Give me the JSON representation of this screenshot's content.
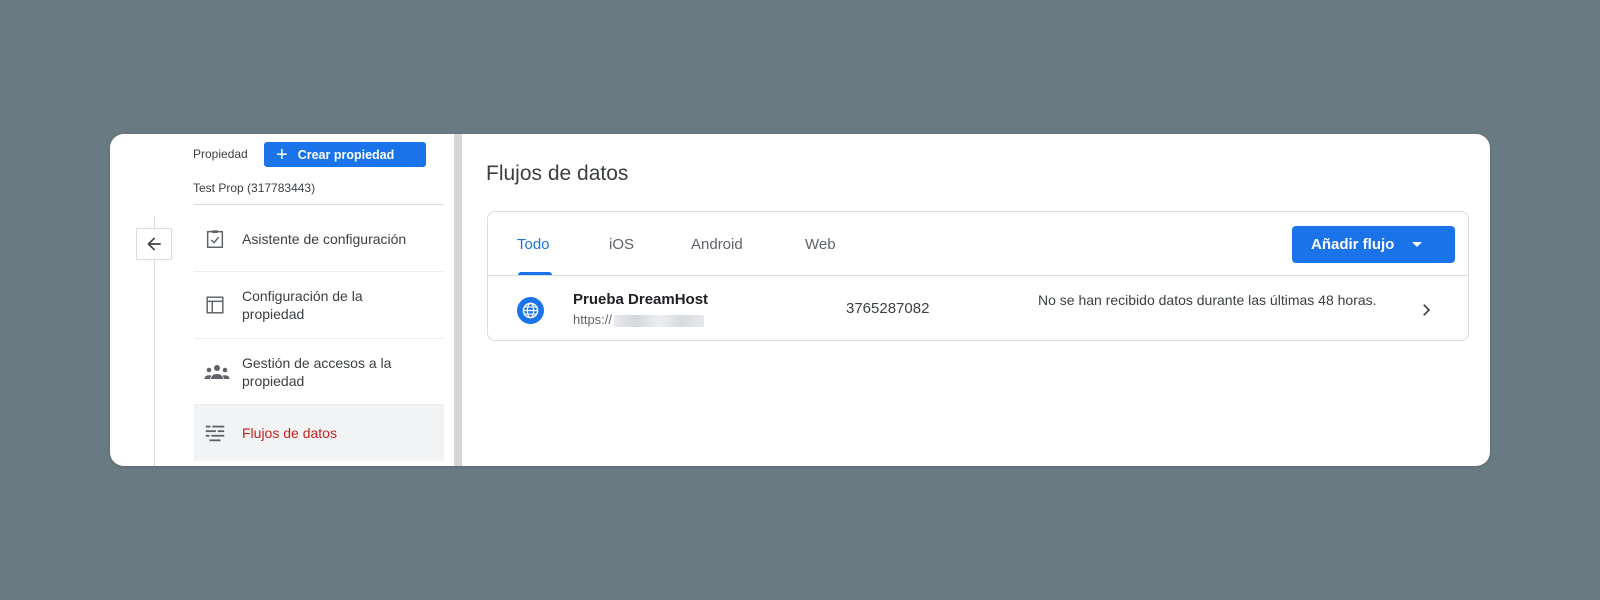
{
  "sidebar": {
    "property_label": "Propiedad",
    "create_property_label": "Crear propiedad",
    "property_name": "Test Prop (317783443)",
    "items": [
      {
        "label": "Asistente de configuración",
        "icon": "clipboard-check-icon",
        "active": false
      },
      {
        "label": "Configuración de la propiedad",
        "icon": "layout-icon",
        "active": false
      },
      {
        "label": "Gestión de accesos a la propiedad",
        "icon": "people-icon",
        "active": false
      },
      {
        "label": "Flujos de datos",
        "icon": "data-streams-icon",
        "active": true
      }
    ]
  },
  "main": {
    "title": "Flujos de datos",
    "tabs": [
      {
        "label": "Todo",
        "active": true
      },
      {
        "label": "iOS",
        "active": false
      },
      {
        "label": "Android",
        "active": false
      },
      {
        "label": "Web",
        "active": false
      }
    ],
    "add_stream_label": "Añadir flujo",
    "streams": [
      {
        "name": "Prueba DreamHost",
        "url_prefix": "https://",
        "id": "3765287082",
        "status": "No se han recibido datos durante las últimas 48 horas.",
        "icon": "globe-icon"
      }
    ]
  },
  "colors": {
    "background": "#697a83",
    "accent": "#1a73e8",
    "active_nav_text": "#c5221f"
  }
}
